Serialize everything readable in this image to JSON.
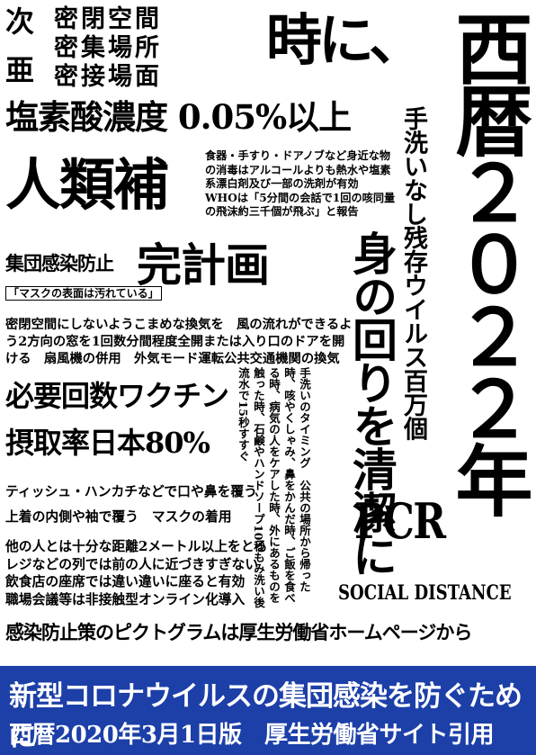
{
  "colors": {
    "banner_bg": "#1c3fa8",
    "banner_text": "#ffffff",
    "text": "#000000"
  },
  "top_left": {
    "label_1": "次",
    "label_2": "亜",
    "rows": [
      "密閉空間",
      "密集場所",
      "密接場面"
    ]
  },
  "headline": "時に、",
  "year_vertical": "西暦２０２２年",
  "oxygen_line": "塩素酸濃度 0.05%以上",
  "handwash_vertical": "手洗いなし残存ウイルス百万個",
  "jinrui": "人類補",
  "disinfect_text": [
    "食器・手すり・ドアノブなど身近な物",
    "の消毒はアルコールよりも熱水や塩素",
    "系漂白剤及び一部の洗剤が有効",
    "WHOは「5分間の会話で1回の咳同量",
    "の飛沫約三千個が飛ぶ」と報告"
  ],
  "cluster": "集団感染防止",
  "kansei": "完計画",
  "mask_note": "「マスクの表面は汚れている」",
  "body_vertical": "身の回りを清潔に",
  "ventilation": [
    "密閉空間にしないようこまめな換気を　風の流れができるよ",
    "う2方向の窓を1回数分間程度全開または入り口のドアを開",
    "ける　扇風機の併用　外気モード運転公共交通機関の換気"
  ],
  "vaccine_1": "必要回数ワクチン",
  "vaccine_2": "摂取率日本80%",
  "wash_timing_vertical": [
    "手洗いのタイミング　公共の場所から帰った",
    "時、咳やくしゃみ、鼻をかんだ時、ご飯を食べ",
    "る時、病気の人をケアした時、外にあるものを",
    "触った時、石鹸やハンドソープ10秒もみ洗い後",
    "流水で15秒すすぐ"
  ],
  "tissue_1": "ティッシュ・ハンカチなどで口や鼻を覆う",
  "tissue_2": "上着の内側や袖で覆う　マスクの着用",
  "pcr": "PCR",
  "distance_text": [
    "他の人とは十分な距離2メートル以上をとる",
    "レジなどの列では前の人に近づきすぎない",
    "飲食店の座席では違い違いに座ると有効",
    "職場会議等は非接触型オンライン化導入"
  ],
  "social_distance": "SOCIAL DISTANCE",
  "pictogram_line": "感染防止策のピクトグラムは厚生労働省ホームページから",
  "banner_line_1": "新型コロナウイルスの集団感染を防ぐために",
  "banner_line_2": "西暦2020年3月1日版　厚生労働省サイト引用"
}
